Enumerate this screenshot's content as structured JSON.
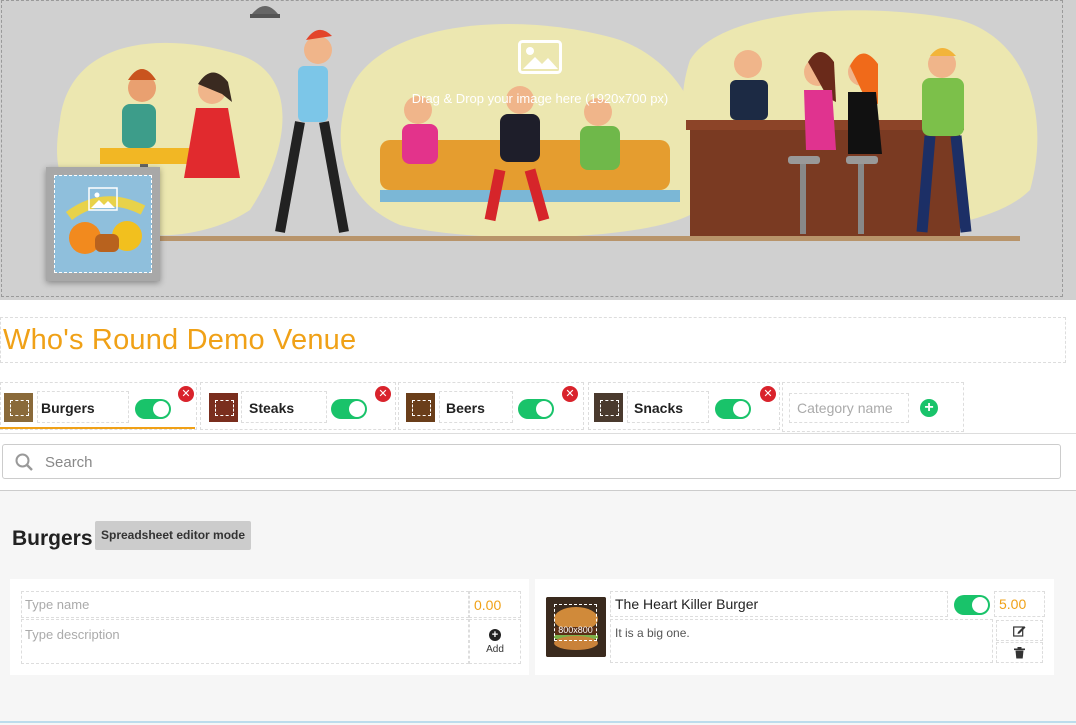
{
  "banner": {
    "hint": "Drag & Drop your image here (1920x700 px)",
    "icon": "image-icon"
  },
  "venue": {
    "title": "Who's Round Demo Venue"
  },
  "categories": [
    {
      "name": "Burgers",
      "enabled": true,
      "active": true
    },
    {
      "name": "Steaks",
      "enabled": true,
      "active": false
    },
    {
      "name": "Beers",
      "enabled": true,
      "active": false
    },
    {
      "name": "Snacks",
      "enabled": true,
      "active": false
    }
  ],
  "new_category": {
    "placeholder": "Category name"
  },
  "search": {
    "placeholder": "Search"
  },
  "section": {
    "title": "Burgers",
    "mode_button": "Spreadsheet editor mode"
  },
  "new_item": {
    "name_placeholder": "Type name",
    "price_placeholder": "0.00",
    "description_placeholder": "Type description",
    "add_label": "Add"
  },
  "items": [
    {
      "name": "The Heart Killer Burger",
      "price": "5.00",
      "description": "It is  a big one.",
      "photo_hint": "800x800",
      "enabled": true
    }
  ],
  "colors": {
    "accent": "#f0a117",
    "toggle_on": "#19c36a",
    "remove": "#d9232c",
    "banner_bg": "#d0d0d0"
  }
}
